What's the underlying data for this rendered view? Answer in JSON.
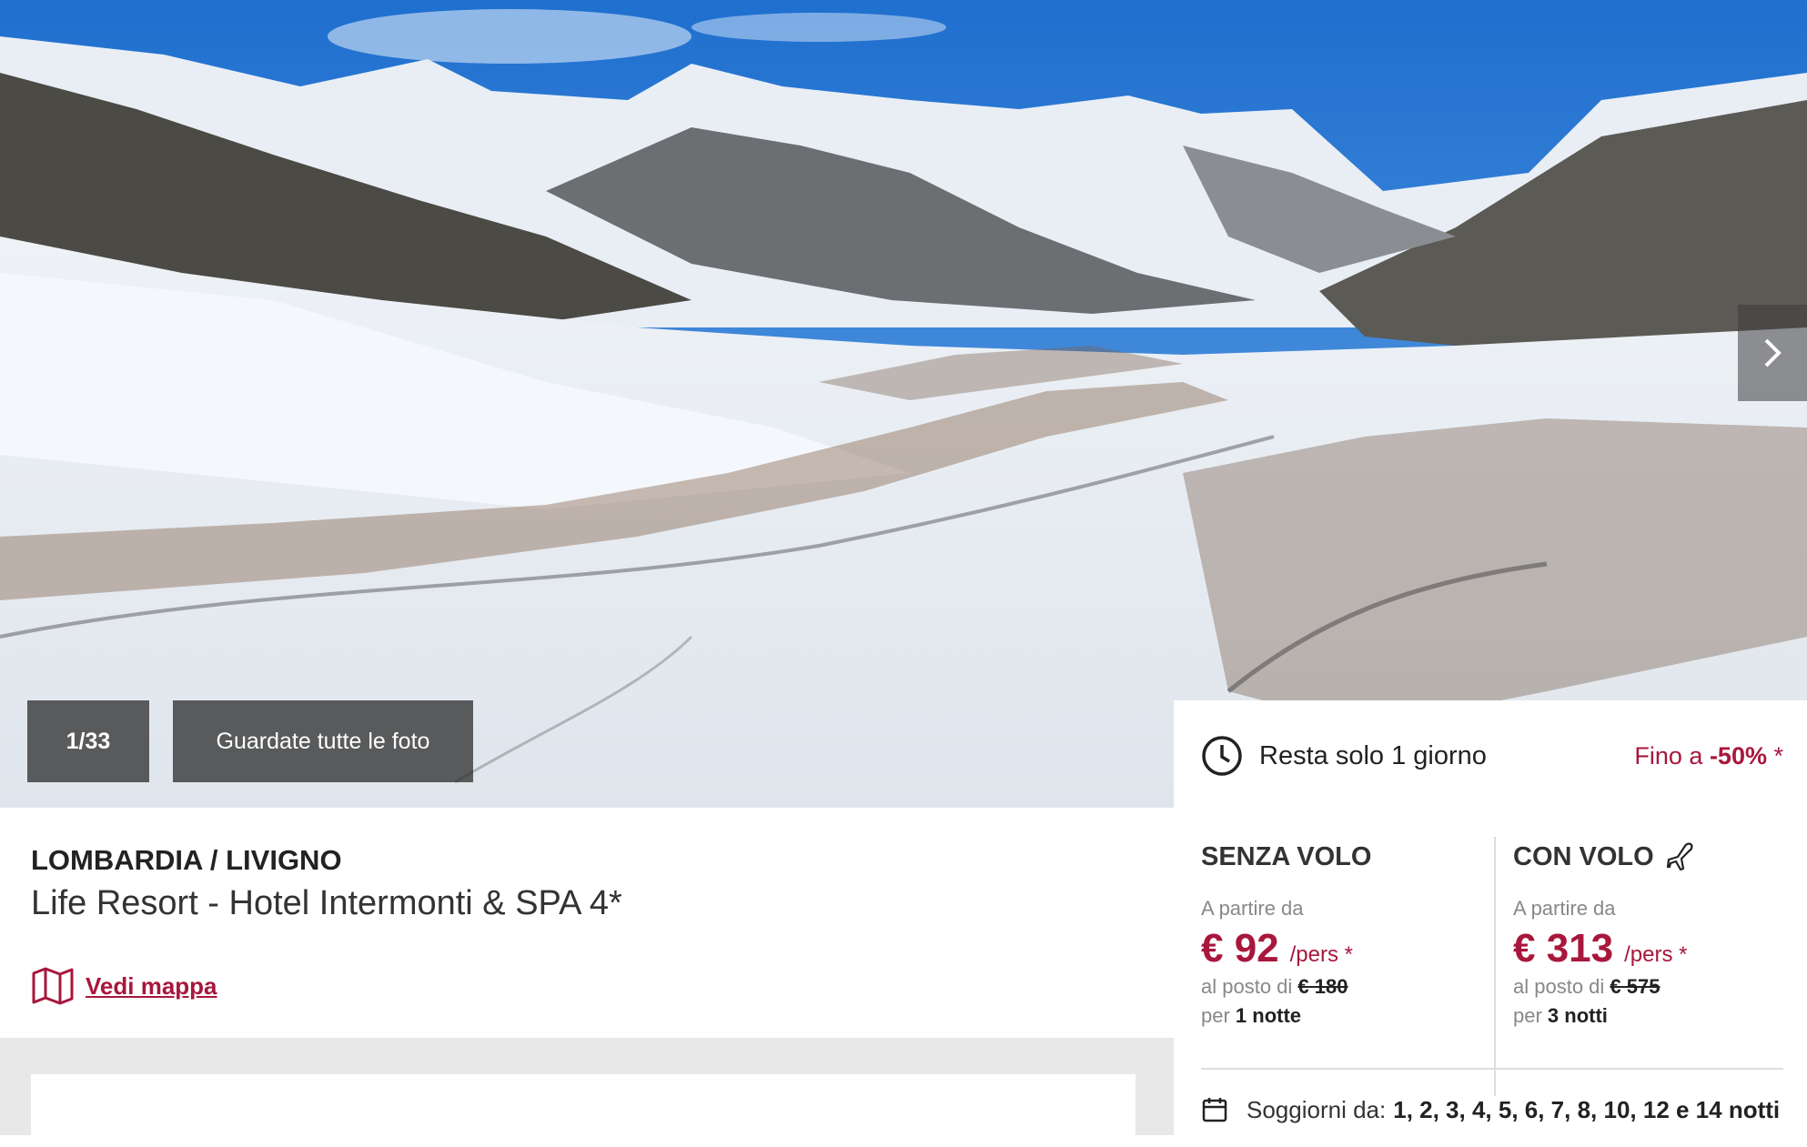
{
  "gallery": {
    "counter": "1/33",
    "all_photos_label": "Guardate tutte le foto",
    "next_icon": "chevron-right-icon"
  },
  "deal": {
    "timer_icon": "clock-icon",
    "time_left": "Resta solo 1 giorno",
    "discount_prefix": "Fino a",
    "discount_value": "-50%",
    "discount_suffix": "*"
  },
  "offers": {
    "without_flight": {
      "title": "SENZA VOLO",
      "from_label": "A partire da",
      "price": "€ 92",
      "per_person": "/pers *",
      "instead_label": "al posto di",
      "old_price": "€ 180",
      "per_label": "per",
      "nights": "1 notte"
    },
    "with_flight": {
      "title": "CON VOLO",
      "icon": "plane-icon",
      "from_label": "A partire da",
      "price": "€ 313",
      "per_person": "/pers *",
      "instead_label": "al posto di",
      "old_price": "€ 575",
      "per_label": "per",
      "nights": "3 notti"
    }
  },
  "stays": {
    "icon": "calendar-icon",
    "label": "Soggiorni da:",
    "values": "1, 2, 3, 4, 5, 6, 7, 8, 10, 12 e 14 notti"
  },
  "hotel": {
    "region": "LOMBARDIA / LIVIGNO",
    "name": "Life Resort - Hotel Intermonti & SPA 4*",
    "map_icon": "map-icon",
    "map_link": "Vedi mappa"
  },
  "colors": {
    "accent": "#a8173c",
    "overlay": "#323232",
    "sky": "#2f7fd6",
    "snow": "#f3f6fa"
  }
}
